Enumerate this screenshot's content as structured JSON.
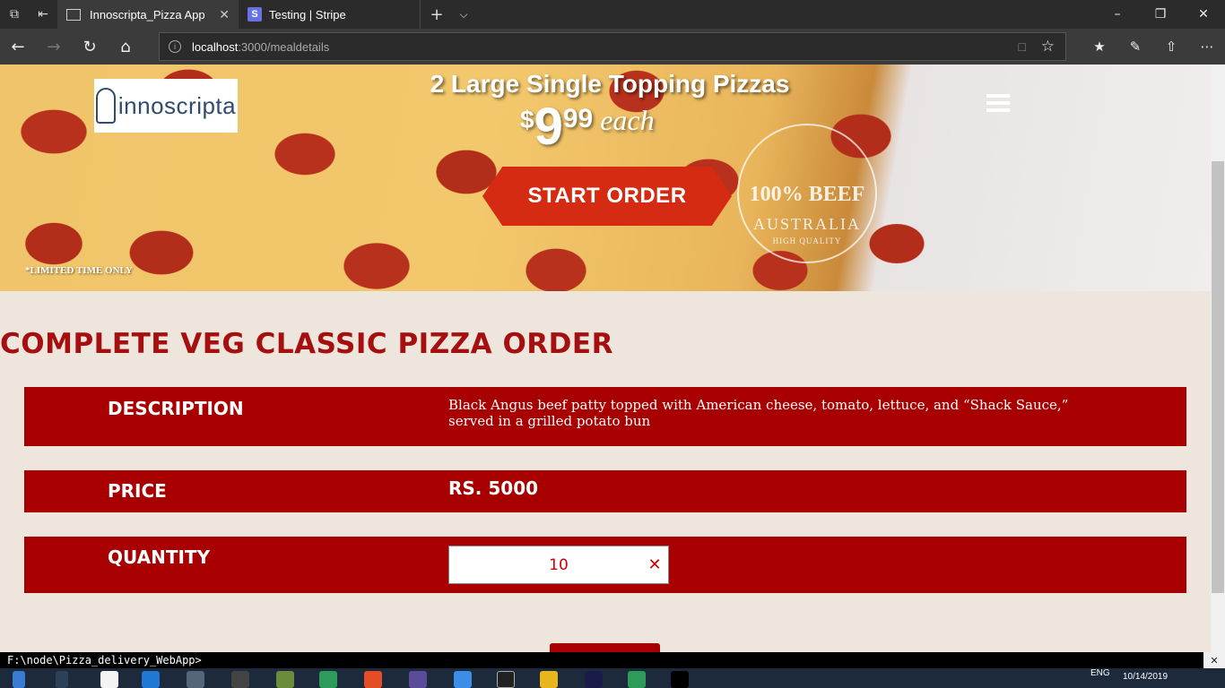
{
  "browser": {
    "tabs": [
      {
        "title": "Innoscripta_Pizza App",
        "active": true
      },
      {
        "title": "Testing | Stripe",
        "active": false,
        "icon_letter": "S"
      }
    ],
    "url_host": "localhost",
    "url_path": ":3000/mealdetails"
  },
  "hero": {
    "logo_text": "innoscripta",
    "title": "2 Large Single Topping Pizzas",
    "price_dollar": "$",
    "price_main": "9",
    "price_cents": "99",
    "price_each": "each",
    "start_order": "START ORDER",
    "badge_line1": "100% BEEF",
    "badge_line2": "AUSTRALIA",
    "badge_line3": "HIGH QUALITY",
    "limited": "*LIMITED TIME ONLY"
  },
  "order": {
    "title": "COMPLETE VEG CLASSIC PIZZA ORDER",
    "description_label": "DESCRIPTION",
    "description_value": "Black Angus beef patty topped with American cheese, tomato, lettuce, and “Shack Sauce,” served in a grilled potato bun",
    "price_label": "PRICE",
    "price_value": "RS. 5000",
    "quantity_label": "QUANTITY",
    "quantity_value": "10"
  },
  "console": {
    "prompt": "F:\\node\\Pizza_delivery_WebApp>"
  },
  "taskbar": {
    "language": "ENG",
    "date": "10/14/2019"
  },
  "colors": {
    "accent": "#a80000",
    "title_red": "#a50f0f",
    "button_red": "#d42b12",
    "page_bg": "#eee6dc"
  }
}
